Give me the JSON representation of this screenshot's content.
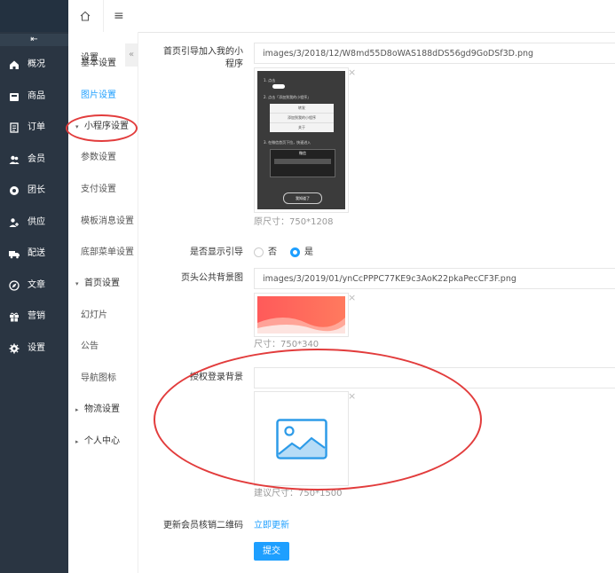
{
  "nav": {
    "toggle_glyph": "⇤",
    "items": [
      {
        "label": "概况",
        "icon": "home-icon"
      },
      {
        "label": "商品",
        "icon": "goods-icon"
      },
      {
        "label": "订单",
        "icon": "order-icon"
      },
      {
        "label": "会员",
        "icon": "member-icon"
      },
      {
        "label": "团长",
        "icon": "leader-icon"
      },
      {
        "label": "供应",
        "icon": "supply-icon"
      },
      {
        "label": "配送",
        "icon": "truck-icon"
      },
      {
        "label": "文章",
        "icon": "compass-icon"
      },
      {
        "label": "营销",
        "icon": "gift-icon"
      },
      {
        "label": "设置",
        "icon": "gear-icon"
      }
    ]
  },
  "topbar": {
    "home_icon": "home-outline-icon",
    "menu_glyph": "≡"
  },
  "sidebar": {
    "title": "设置",
    "collapse_glyph": "«",
    "items": [
      {
        "label": "基本设置"
      },
      {
        "label": "图片设置"
      },
      {
        "label": "小程序设置",
        "arrow": "▾"
      },
      {
        "label": "参数设置"
      },
      {
        "label": "支付设置"
      },
      {
        "label": "模板消息设置"
      },
      {
        "label": "底部菜单设置"
      },
      {
        "label": "首页设置",
        "arrow": "▾"
      },
      {
        "label": "幻灯片"
      },
      {
        "label": "公告"
      },
      {
        "label": "导航图标"
      },
      {
        "label": "物流设置",
        "arrow": "▸"
      },
      {
        "label": "个人中心",
        "arrow": "▸"
      }
    ]
  },
  "form": {
    "guide": {
      "label_line1": "首页引导加入我的小",
      "label_line2": "程序",
      "value": "images/3/2018/12/W8md55D8oWAS188dDS56gd9GoDSf3D.png",
      "hint": "原尺寸：750*1208",
      "preview": {
        "step1": "1. 点击",
        "step2": "2. 点击「添加到我的小程序」",
        "menu1": "转发",
        "menu2": "添加到我的小程序",
        "menu3": "关于",
        "step3": "3. 在微信首页下拉，快速进入",
        "bar_title": "微信",
        "btn": "我知道了"
      }
    },
    "show_guide": {
      "label": "是否显示引导",
      "options": [
        "否",
        "是"
      ],
      "selected": "是"
    },
    "header_bg": {
      "label": "页头公共背景图",
      "value": "images/3/2019/01/ynCcPPPC77KE9c3AoK22pkaPecCF3F.png",
      "hint": "尺寸：750*340"
    },
    "auth_bg": {
      "label": "授权登录背景",
      "value": "",
      "hint": "建议尺寸：750*1500"
    },
    "qrcode": {
      "label": "更新会员核销二维码",
      "link": "立即更新"
    },
    "submit": "提交",
    "close_glyph": "×"
  },
  "colors": {
    "accent": "#1e9fff",
    "nav_bg": "#2a3542",
    "annotation": "#e23c3c"
  }
}
